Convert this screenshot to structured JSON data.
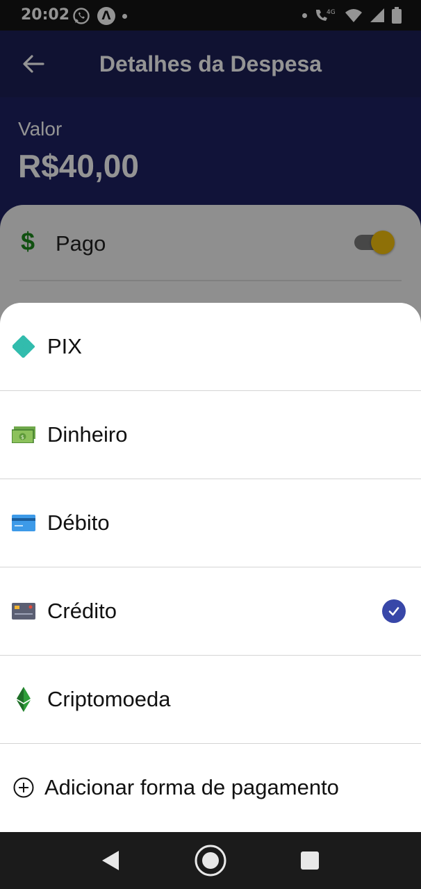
{
  "status_bar": {
    "time": "20:02",
    "network": "4G"
  },
  "app_bar": {
    "title": "Detalhes da Despesa"
  },
  "header": {
    "valor_label": "Valor",
    "valor_amount": "R$40,00"
  },
  "card": {
    "dollar_symbol": "$",
    "pago_label": "Pago",
    "pago_enabled": true
  },
  "payment_sheet": {
    "items": [
      {
        "label": "PIX",
        "icon": "pix-icon",
        "selected": false
      },
      {
        "label": "Dinheiro",
        "icon": "cash-icon",
        "selected": false
      },
      {
        "label": "Débito",
        "icon": "debit-card-icon",
        "selected": false
      },
      {
        "label": "Crédito",
        "icon": "credit-card-icon",
        "selected": true
      },
      {
        "label": "Criptomoeda",
        "icon": "crypto-icon",
        "selected": false
      }
    ],
    "add_label": "Adicionar forma de pagamento"
  },
  "colors": {
    "primary": "#1c1f56",
    "accent": "#f4c20d",
    "check": "#3847a8",
    "pix": "#32bcad"
  }
}
